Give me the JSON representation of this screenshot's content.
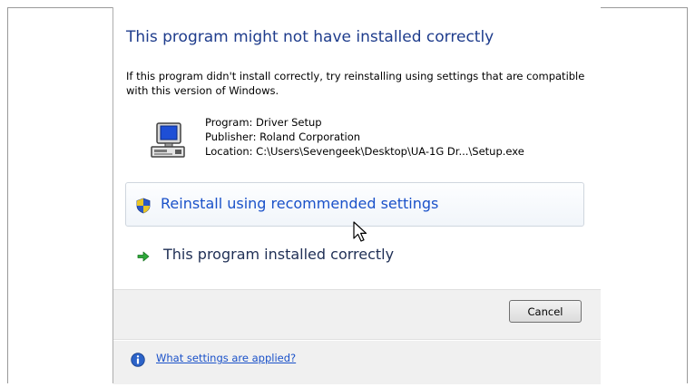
{
  "dialog": {
    "title": "This program might not have installed correctly",
    "description": "If this program didn't install correctly, try reinstalling using settings that are compatible with this version of Windows.",
    "program_line": "Program: Driver Setup",
    "publisher_line": "Publisher: Roland Corporation",
    "location_line": "Location: C:\\Users\\Sevengeek\\Desktop\\UA-1G Dr...\\Setup.exe",
    "program_icon": "computer-setup-icon"
  },
  "commands": {
    "reinstall_label": "Reinstall using recommended settings",
    "reinstall_icon": "uac-shield-icon",
    "installed_label": "This program installed correctly",
    "installed_icon": "green-arrow-icon"
  },
  "footer": {
    "cancel_label": "Cancel",
    "help_link": "What settings are applied?",
    "help_icon": "info-icon"
  },
  "colors": {
    "title": "#1e3c8c",
    "link": "#1a51c9",
    "footer_bg": "#f0f0f0"
  }
}
